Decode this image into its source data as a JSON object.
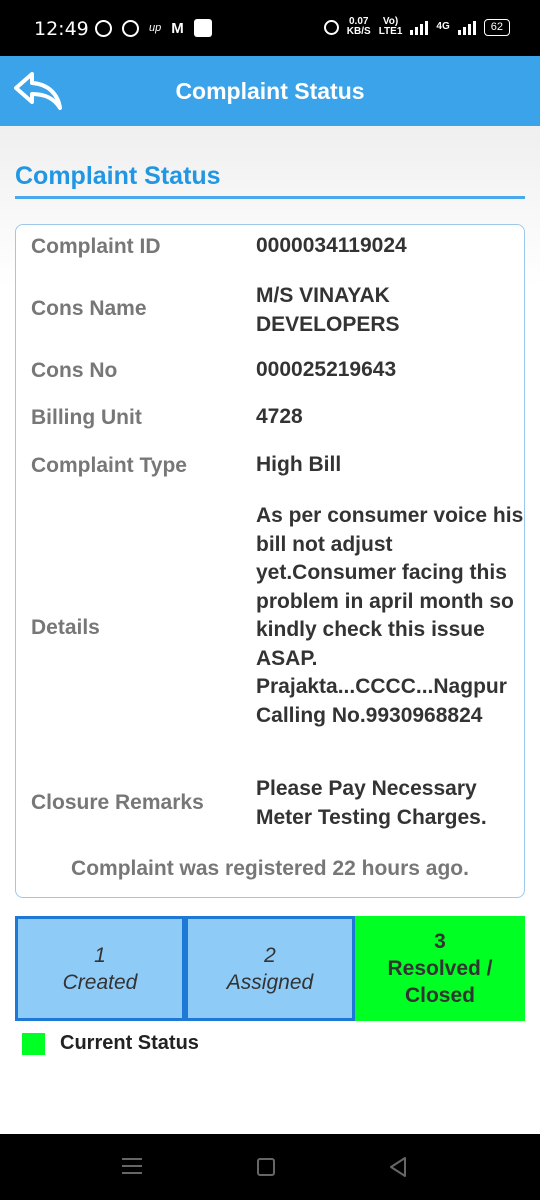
{
  "statusbar": {
    "time": "12:49",
    "speed_top": "0.07",
    "speed_bottom": "KB/S",
    "vo_top": "Vo)",
    "vo_bottom": "LTE1",
    "net2": "4G",
    "battery": "62"
  },
  "header": {
    "title": "Complaint Status"
  },
  "section": {
    "title": "Complaint Status"
  },
  "details": {
    "complaint_id_label": "Complaint ID",
    "complaint_id": "0000034119024",
    "cons_name_label": "Cons Name",
    "cons_name": "M/S VINAYAK DEVELOPERS",
    "cons_no_label": "Cons No",
    "cons_no": "000025219643",
    "billing_unit_label": "Billing Unit",
    "billing_unit": "4728",
    "complaint_type_label": "Complaint Type",
    "complaint_type": "High Bill",
    "details_label": "Details",
    "details_text": "As per consumer voice his bill not adjust yet.Consumer facing this problem in april month so kindly check this issue ASAP. Prajakta...CCCC...Nagpur",
    "calling_no": "Calling No.9930968824",
    "closure_label": "Closure Remarks",
    "closure_text": "Please Pay Necessary Meter Testing Charges.",
    "registered_text": "Complaint was registered 22 hours ago."
  },
  "steps": [
    {
      "number": "1",
      "label": "Created"
    },
    {
      "number": "2",
      "label": "Assigned"
    },
    {
      "number": "3",
      "label": "Resolved / Closed"
    }
  ],
  "legend": {
    "label": "Current Status"
  },
  "colors": {
    "header_bg": "#3aa3e9",
    "accent": "#2196e3",
    "step_pending": "#8ecbf6",
    "step_current": "#00ff22"
  },
  "icons": {
    "back": "back-arrow-icon"
  }
}
